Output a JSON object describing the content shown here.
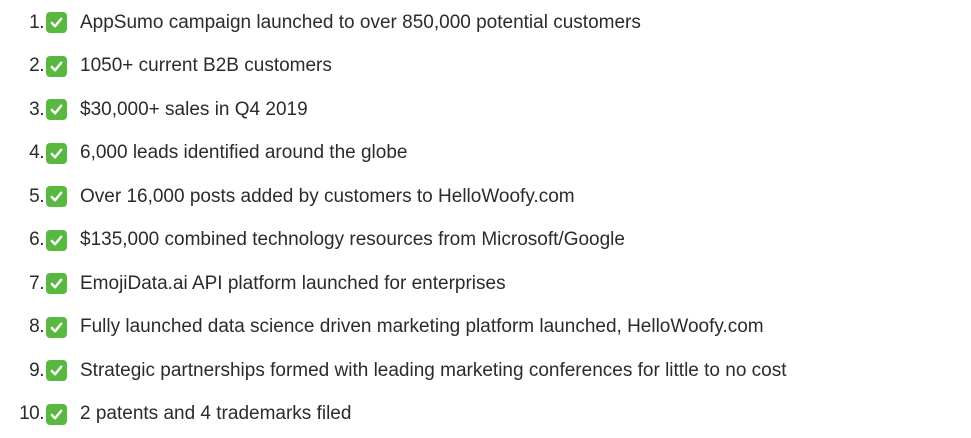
{
  "list": {
    "items": [
      {
        "number": "1.",
        "icon": "check-mark-icon",
        "text": "AppSumo campaign launched to over 850,000 potential customers"
      },
      {
        "number": "2.",
        "icon": "check-mark-icon",
        "text": "1050+ current B2B customers"
      },
      {
        "number": "3.",
        "icon": "check-mark-icon",
        "text": "$30,000+ sales in Q4 2019"
      },
      {
        "number": "4.",
        "icon": "check-mark-icon",
        "text": "6,000 leads identified around the globe"
      },
      {
        "number": "5.",
        "icon": "check-mark-icon",
        "text": "Over 16,000 posts added by customers to HelloWoofy.com"
      },
      {
        "number": "6.",
        "icon": "check-mark-icon",
        "text": "$135,000 combined technology resources from Microsoft/Google"
      },
      {
        "number": "7.",
        "icon": "check-mark-icon",
        "text": "EmojiData.ai API platform launched for enterprises"
      },
      {
        "number": "8.",
        "icon": "check-mark-icon",
        "text": "Fully launched data science driven marketing platform launched, HelloWoofy.com"
      },
      {
        "number": "9.",
        "icon": "check-mark-icon",
        "text": "Strategic partnerships formed with leading marketing conferences for little to no cost"
      },
      {
        "number": "10.",
        "icon": "check-mark-icon",
        "text": "2 patents and 4 trademarks filed"
      }
    ]
  },
  "colors": {
    "check_background": "#58b83f",
    "check_mark": "#ffffff",
    "text": "#2b2b2b"
  }
}
